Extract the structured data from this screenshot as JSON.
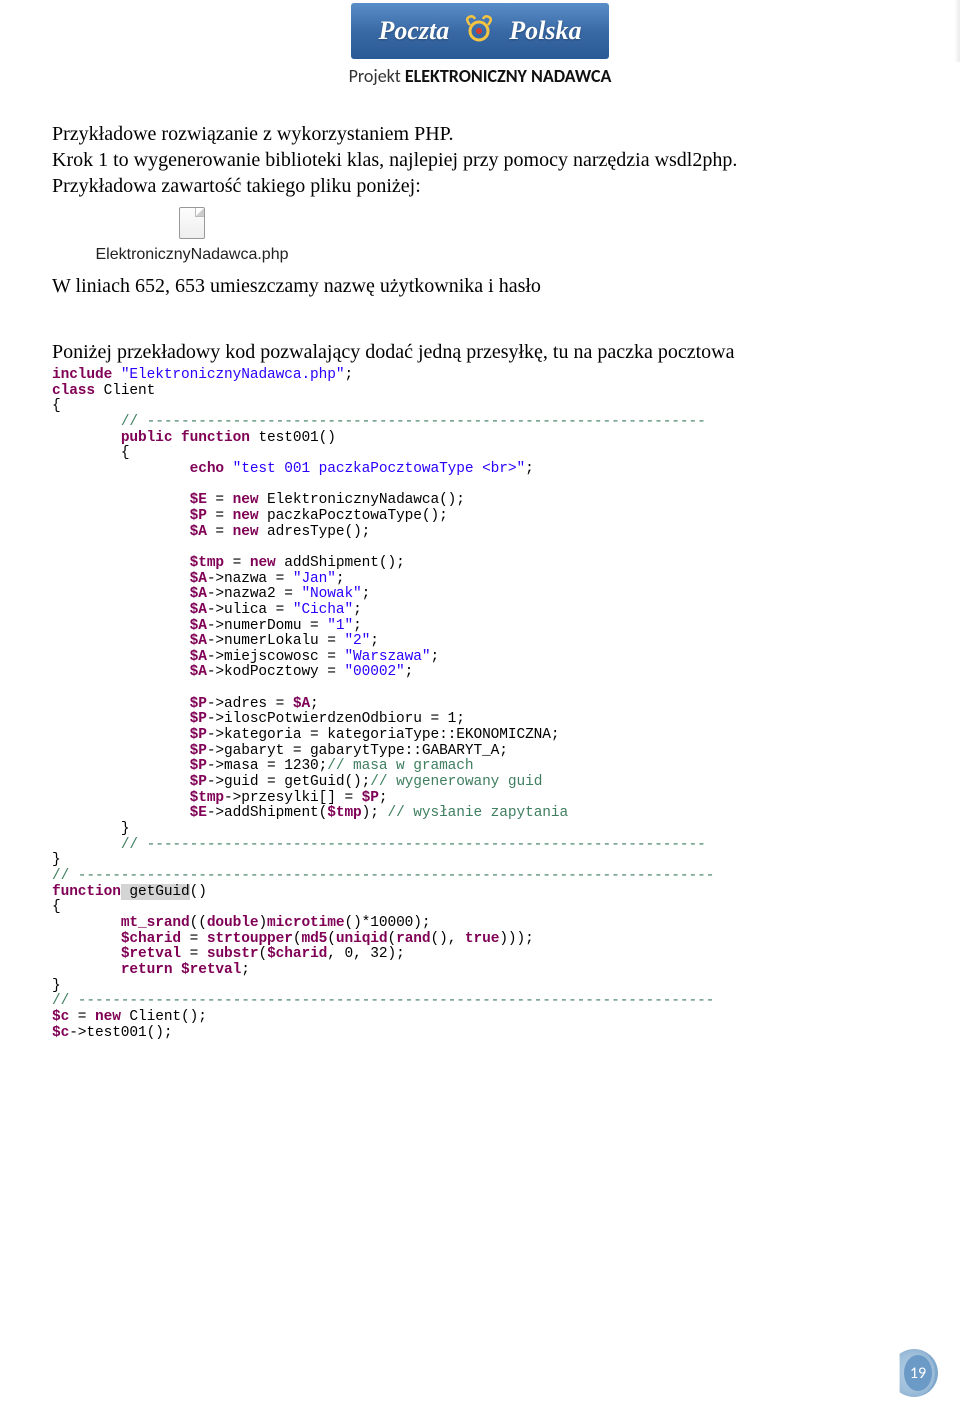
{
  "header": {
    "logo_left": "Poczta",
    "logo_right": "Polska",
    "project_part1": "Projekt ",
    "project_part2": "ELEKTRONICZNY NADAWCA"
  },
  "body": {
    "line1": "Przykładowe rozwiązanie z wykorzystaniem PHP.",
    "line2": "Krok 1 to wygenerowanie biblioteki klas, najlepiej przy pomocy narzędzia wsdl2php.",
    "line3": "Przykładowa zawartość takiego pliku poniżej:",
    "file_label": "ElektronicznyNadawca.php",
    "line4": "W liniach 652, 653 umieszczamy nazwę użytkownika i hasło",
    "line5": "Poniżej przekładowy kod pozwalający dodać jedną przesyłkę, tu na paczka pocztowa"
  },
  "code": {
    "l01_kw1": "include",
    "l01_str": "\"ElektronicznyNadawca.php\"",
    "l01_end": ";",
    "l02_kw": "class",
    "l02_name": " Client",
    "l03": "{",
    "l04_ind": "        ",
    "l04_comm": "// -----------------------------------------------------------------",
    "l05_ind": "        ",
    "l05_kw1": "public",
    "l05_kw2": " function",
    "l05_rest": " test001()",
    "l06_ind": "        ",
    "l06": "{",
    "l07_ind": "                ",
    "l07_kw": "echo",
    "l07_str": " \"test 001 paczkaPocztowaType <br>\"",
    "l07_end": ";",
    "l08_ind": "                ",
    "l08_var": "$E",
    "l08_op": " = ",
    "l08_kw": "new",
    "l08_rest": " ElektronicznyNadawca();",
    "l09_ind": "                ",
    "l09_var": "$P",
    "l09_op": " = ",
    "l09_kw": "new",
    "l09_rest": " paczkaPocztowaType();",
    "l10_ind": "                ",
    "l10_var": "$A",
    "l10_op": " = ",
    "l10_kw": "new",
    "l10_rest": " adresType();",
    "l11_ind": "                ",
    "l11_var": "$tmp",
    "l11_op": " = ",
    "l11_kw": "new",
    "l11_rest": " addShipment();",
    "l12_ind": "                ",
    "l12_var": "$A",
    "l12_rest": "->nazwa = ",
    "l12_str": "\"Jan\"",
    "l12_end": ";",
    "l13_ind": "                ",
    "l13_var": "$A",
    "l13_rest": "->nazwa2 = ",
    "l13_str": "\"Nowak\"",
    "l13_end": ";",
    "l14_ind": "                ",
    "l14_var": "$A",
    "l14_rest": "->ulica = ",
    "l14_str": "\"Cicha\"",
    "l14_end": ";",
    "l15_ind": "                ",
    "l15_var": "$A",
    "l15_rest": "->numerDomu = ",
    "l15_str": "\"1\"",
    "l15_end": ";",
    "l16_ind": "                ",
    "l16_var": "$A",
    "l16_rest": "->numerLokalu = ",
    "l16_str": "\"2\"",
    "l16_end": ";",
    "l17_ind": "                ",
    "l17_var": "$A",
    "l17_rest": "->miejscowosc = ",
    "l17_str": "\"Warszawa\"",
    "l17_end": ";",
    "l18_ind": "                ",
    "l18_var": "$A",
    "l18_rest": "->kodPocztowy = ",
    "l18_str": "\"00002\"",
    "l18_end": ";",
    "l19_ind": "                ",
    "l19_var": "$P",
    "l19_rest": "->adres = ",
    "l19_var2": "$A",
    "l19_end": ";",
    "l20_ind": "                ",
    "l20_var": "$P",
    "l20_rest": "->iloscPotwierdzenOdbioru = 1;",
    "l21_ind": "                ",
    "l21_var": "$P",
    "l21_rest": "->kategoria = kategoriaType::EKONOMICZNA;",
    "l22_ind": "                ",
    "l22_var": "$P",
    "l22_rest": "->gabaryt = gabarytType::GABARYT_A;",
    "l23_ind": "                ",
    "l23_var": "$P",
    "l23_rest": "->masa = 1230;",
    "l23_comm": "// masa w gramach",
    "l24_ind": "                ",
    "l24_var": "$P",
    "l24_rest": "->guid = getGuid();",
    "l24_comm": "// wygenerowany guid",
    "l25_ind": "                ",
    "l25_var": "$tmp",
    "l25_rest": "->przesylki[] = ",
    "l25_var2": "$P",
    "l25_end": ";",
    "l26_ind": "                ",
    "l26_var": "$E",
    "l26_rest": "->addShipment(",
    "l26_var2": "$tmp",
    "l26_end": "); ",
    "l26_comm": "// wysłanie zapytania",
    "l27_ind": "        ",
    "l27": "}",
    "l28_ind": "        ",
    "l28_comm": "// -----------------------------------------------------------------",
    "l29": "}",
    "l30_comm": "// --------------------------------------------------------------------------",
    "l31_kw": "function",
    "l31_fn": " getGuid",
    "l31_end": "()",
    "l32": "{",
    "l33_ind": "        ",
    "l33_fn1": "mt_srand",
    "l33_p1": "((",
    "l33_cast": "double",
    "l33_p2": ")",
    "l33_fn2": "microtime",
    "l33_p3": "()*10000);",
    "l34_ind": "        ",
    "l34_var": "$charid",
    "l34_op": " = ",
    "l34_fn1": "strtoupper",
    "l34_p1": "(",
    "l34_fn2": "md5",
    "l34_p2": "(",
    "l34_fn3": "uniqid",
    "l34_p3": "(",
    "l34_fn4": "rand",
    "l34_p4": "(), ",
    "l34_kw": "true",
    "l34_p5": ")));",
    "l35_ind": "        ",
    "l35_var": "$retval",
    "l35_op": " = ",
    "l35_fn": "substr",
    "l35_p1": "(",
    "l35_var2": "$charid",
    "l35_p2": ", 0, 32);",
    "l36_ind": "        ",
    "l36_kw": "return",
    "l36_sp": " ",
    "l36_var": "$retval",
    "l36_end": ";",
    "l37": "}",
    "l38_comm": "// --------------------------------------------------------------------------",
    "l39_var": "$c",
    "l39_op": " = ",
    "l39_kw": "new",
    "l39_rest": " Client();",
    "l40_var": "$c",
    "l40_rest": "->test001();"
  },
  "page_number": "19"
}
